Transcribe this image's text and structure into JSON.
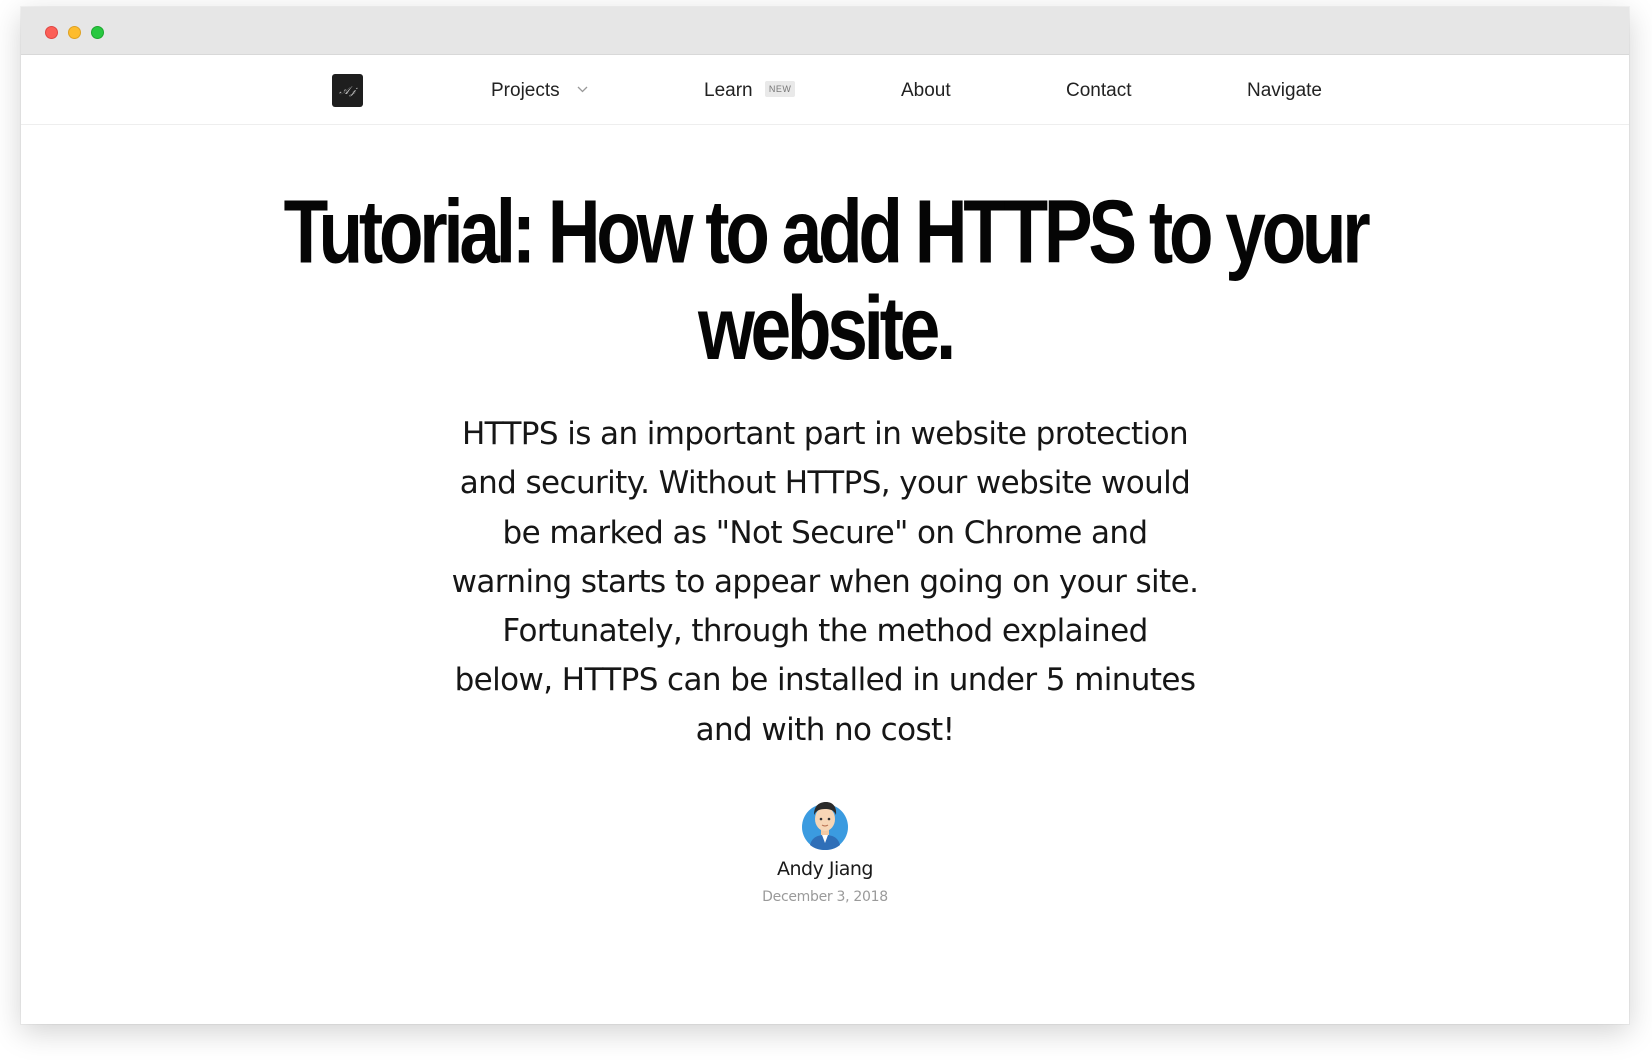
{
  "window": {
    "controls": [
      "close",
      "minimize",
      "maximize"
    ]
  },
  "nav": {
    "logo_icon": "signature-logo-icon",
    "items": [
      {
        "label": "Projects",
        "icon": "chevron-down-icon"
      },
      {
        "label": "Learn",
        "badge": "NEW"
      },
      {
        "label": "About"
      },
      {
        "label": "Contact"
      },
      {
        "label": "Navigate"
      }
    ]
  },
  "article": {
    "title_lines": [
      "Tutorial: How to add HTTPS to your",
      "website."
    ],
    "lede_lines": [
      "HTTPS is an important part in website protection",
      "and security. Without HTTPS, your website would",
      "be marked as \"Not Secure\" on Chrome and",
      "warning starts to appear when going on your site.",
      "Fortunately, through the method explained",
      "below, HTTPS can be installed in under 5 minutes",
      "and with no cost!"
    ],
    "author": {
      "name": "Andy Jiang",
      "date": "December 3, 2018",
      "avatar_icon": "author-avatar"
    }
  },
  "colors": {
    "titlebar": "#e6e6e6",
    "text": "#161616",
    "muted": "#9a9a9a",
    "avatar_bg": "#3b9be0"
  }
}
